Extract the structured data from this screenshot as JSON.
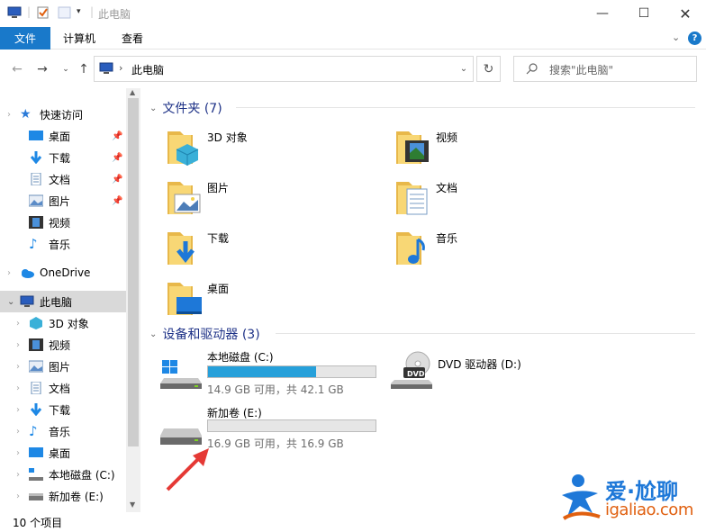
{
  "window": {
    "title": "此电脑"
  },
  "ribbon": {
    "tabs": [
      "文件",
      "计算机",
      "查看"
    ]
  },
  "address": {
    "path": "此电脑",
    "search_placeholder": "搜索\"此电脑\""
  },
  "nav": {
    "quick_access": "快速访问",
    "quick_items": [
      "桌面",
      "下载",
      "文档",
      "图片",
      "视频",
      "音乐"
    ],
    "onedrive": "OneDrive",
    "this_pc": "此电脑",
    "pc_items": [
      "3D 对象",
      "视频",
      "图片",
      "文档",
      "下载",
      "音乐",
      "桌面",
      "本地磁盘 (C:)",
      "新加卷 (E:)"
    ]
  },
  "folders": {
    "header": "文件夹 (7)",
    "items": [
      "3D 对象",
      "视频",
      "图片",
      "文档",
      "下载",
      "音乐",
      "桌面"
    ]
  },
  "drives": {
    "header": "设备和驱动器 (3)",
    "c": {
      "label": "本地磁盘 (C:)",
      "info": "14.9 GB 可用，共 42.1 GB",
      "used_fraction": 0.646
    },
    "dvd": {
      "label": "DVD 驱动器 (D:)"
    },
    "e": {
      "label": "新加卷 (E:)",
      "info": "16.9 GB 可用，共 16.9 GB",
      "used_fraction": 0.0
    }
  },
  "status": {
    "items": "10 个项目"
  },
  "watermark": {
    "text": "爱·尬聊",
    "url": "igaliao.com"
  },
  "colors": {
    "accent": "#1979ca",
    "bar": "#26a0da",
    "header": "#1e3287",
    "arrow": "#e53935"
  }
}
